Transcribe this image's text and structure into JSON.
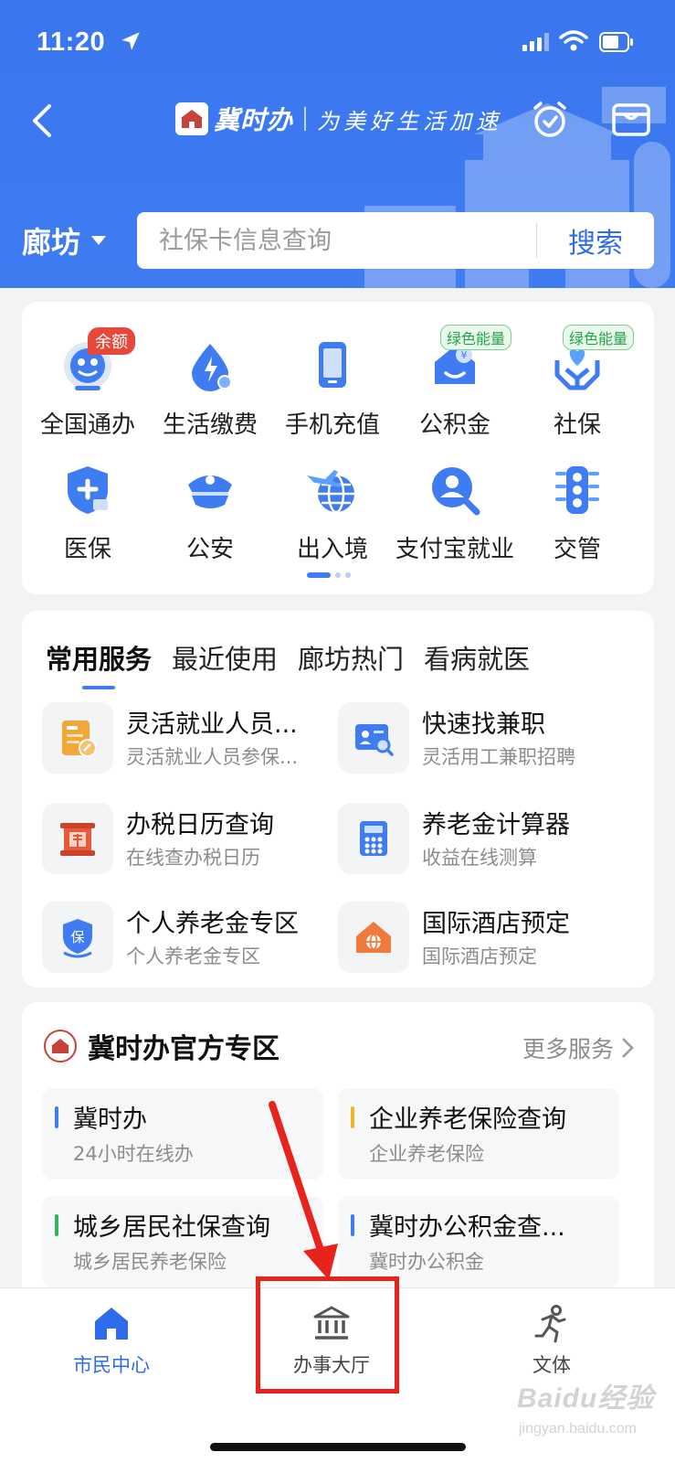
{
  "status_bar": {
    "time": "11:20"
  },
  "header": {
    "brand_name": "冀时办",
    "slogan": "为美好生活加速",
    "city": "廊坊",
    "search_placeholder": "社保卡信息查询",
    "search_button": "搜索"
  },
  "grid": {
    "items": [
      {
        "label": "全国通办",
        "icon": "globe-avatar-icon",
        "badge": "余额"
      },
      {
        "label": "生活缴费",
        "icon": "water-drop-bolt-icon"
      },
      {
        "label": "手机充值",
        "icon": "phone-icon"
      },
      {
        "label": "公积金",
        "icon": "housing-fund-icon",
        "badge": "绿色能量"
      },
      {
        "label": "社保",
        "icon": "heart-hands-icon",
        "badge": "绿色能量"
      },
      {
        "label": "医保",
        "icon": "medical-shield-icon"
      },
      {
        "label": "公安",
        "icon": "police-cap-icon"
      },
      {
        "label": "出入境",
        "icon": "plane-globe-icon"
      },
      {
        "label": "支付宝就业",
        "icon": "job-search-icon"
      },
      {
        "label": "交管",
        "icon": "traffic-light-icon"
      }
    ]
  },
  "services": {
    "tabs": [
      "常用服务",
      "最近使用",
      "廊坊热门",
      "看病就医"
    ],
    "active_tab": "常用服务",
    "items": [
      {
        "title": "灵活就业人员...",
        "subtitle": "灵活就业人员参保...",
        "icon": "insurance-form-icon"
      },
      {
        "title": "快速找兼职",
        "subtitle": "灵活用工兼职招聘",
        "icon": "id-card-search-icon"
      },
      {
        "title": "办税日历查询",
        "subtitle": "在线查办税日历",
        "icon": "tax-calendar-icon"
      },
      {
        "title": "养老金计算器",
        "subtitle": "收益在线测算",
        "icon": "calculator-icon"
      },
      {
        "title": "个人养老金专区",
        "subtitle": "个人养老金专区",
        "icon": "pension-shield-icon"
      },
      {
        "title": "国际酒店预定",
        "subtitle": "国际酒店预定",
        "icon": "hotel-house-icon"
      }
    ]
  },
  "zone": {
    "title": "冀时办官方专区",
    "more": "更多服务",
    "items": [
      {
        "title": "冀时办",
        "subtitle": "24小时在线办",
        "bar_color": "#3f7cf2"
      },
      {
        "title": "企业养老保险查询",
        "subtitle": "企业养老保险",
        "bar_color": "#f0b429"
      },
      {
        "title": "城乡居民社保查询",
        "subtitle": "城乡居民养老保险",
        "bar_color": "#34b35a"
      },
      {
        "title": "冀时办公积金查...",
        "subtitle": "冀时办公积金",
        "bar_color": "#3f7cf2"
      }
    ]
  },
  "tabbar": {
    "items": [
      {
        "label": "市民中心",
        "icon": "home-icon",
        "active": true
      },
      {
        "label": "办事大厅",
        "icon": "bank-hall-icon",
        "active": false
      },
      {
        "label": "文体",
        "icon": "running-person-icon",
        "active": false
      }
    ]
  },
  "watermark": {
    "text": "Baidu经验",
    "sub": "jingyan.baidu.com"
  },
  "colors": {
    "primary": "#3f7cf2",
    "annotation_red": "#e8231c",
    "badge_red": "#e8473c",
    "badge_green": "#2aa148"
  }
}
